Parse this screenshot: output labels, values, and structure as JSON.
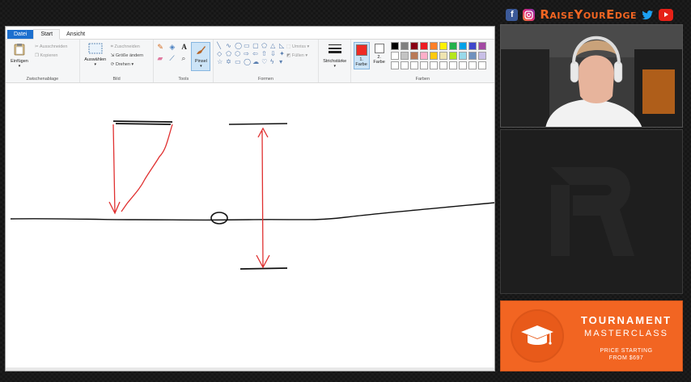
{
  "brand": {
    "name": "RaiseYourEdge",
    "icons": [
      "facebook-icon",
      "instagram-icon",
      "twitter-icon",
      "youtube-icon"
    ],
    "accent": "#f26522"
  },
  "paint": {
    "tabs": [
      "Datei",
      "Start",
      "Ansicht"
    ],
    "clipboard": {
      "paste": "Einfügen",
      "cut": "Ausschneiden",
      "copy": "Kopieren",
      "label": "Zwischenablage"
    },
    "image": {
      "select": "Auswählen",
      "crop": "Zuschneiden",
      "resize": "Größe ändern",
      "rotate": "Drehen",
      "label": "Bild"
    },
    "tools": {
      "label": "Tools",
      "brush": "Pinsel"
    },
    "shapes": {
      "outline": "Umriss",
      "fill": "Füllen",
      "label": "Formen"
    },
    "stroke": {
      "label": "Strichstärke"
    },
    "color1": {
      "line1": "1.",
      "line2": "Farbe",
      "value": "#ee2b25"
    },
    "color2": {
      "line1": "2.",
      "line2": "Farbe",
      "value": "#ffffff"
    },
    "colors_label": "Farben",
    "palette": [
      "#000000",
      "#7f7f7f",
      "#880015",
      "#ed1c24",
      "#ff7f27",
      "#fff200",
      "#22b14c",
      "#00a2e8",
      "#3f48cc",
      "#a349a4",
      "#ffffff",
      "#c3c3c3",
      "#b97a57",
      "#ffaec9",
      "#ffc90e",
      "#efe4b0",
      "#b5e61d",
      "#99d9ea",
      "#7092be",
      "#c8bfe7",
      "#ffffff",
      "#ffffff",
      "#ffffff",
      "#ffffff",
      "#ffffff",
      "#ffffff",
      "#ffffff",
      "#ffffff",
      "#ffffff",
      "#ffffff"
    ]
  },
  "ad": {
    "title": "TOURNAMENT",
    "subtitle": "MASTERCLASS",
    "price_line1": "PRICE STARTING",
    "price_line2": "FROM $697",
    "color": "#f26522"
  }
}
